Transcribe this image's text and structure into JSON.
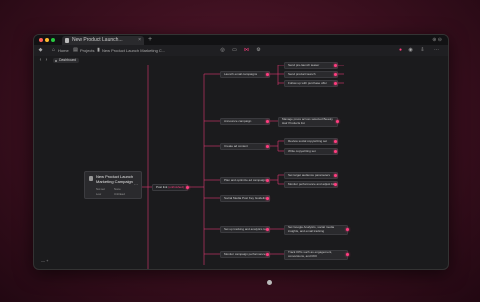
{
  "window": {
    "tab_title": "New Product Launch...",
    "new_tab": "+",
    "top_right": "⊕ ⊖"
  },
  "toolbar": {
    "home_label": "Home",
    "projects_label": "Projects",
    "doc_title": "New Product Launch Marketing C..."
  },
  "navbar": {
    "dashboard_label": "Dashboard"
  },
  "root": {
    "title": "New Product Launch Marketing Campaign",
    "meta1": "Not set",
    "meta2": "None",
    "meta3": "Low",
    "meta4": "Unlinked"
  },
  "level1": {
    "label": "Post link",
    "status": "(unfinished)"
  },
  "branches": [
    {
      "label": "Launch email campaigns"
    },
    {
      "label": "Announce campaign"
    },
    {
      "label": "Create ad content"
    },
    {
      "label": "Plan and optimize ad campaigns"
    },
    {
      "label": "Social Media Post Key Guidelines"
    },
    {
      "label": "Set up tracking and analytics tools"
    },
    {
      "label": "Monitor campaign performance"
    }
  ],
  "leaves": [
    {
      "label": "Send pre-launch teaser"
    },
    {
      "label": "Send product launch"
    },
    {
      "label": "Follow up with purchase offer"
    },
    {
      "label": "Manage press across selected Beauty Hair Products list"
    },
    {
      "label": "Review social copywriting set"
    },
    {
      "label": "Write copywriting set"
    },
    {
      "label": "Set target audience parameters"
    },
    {
      "label": "Monitor performance and adjust bids"
    },
    {
      "label": "Set Google Analytics, social media insights, and email tracking"
    },
    {
      "label": "Track KPIs such as engagement, conversions, and ROI"
    }
  ],
  "zoom": {
    "label": "— +"
  },
  "colors": {
    "accent": "#ff3d7f",
    "canvas": "#1b1b1d",
    "node": "#2a2a2d"
  }
}
